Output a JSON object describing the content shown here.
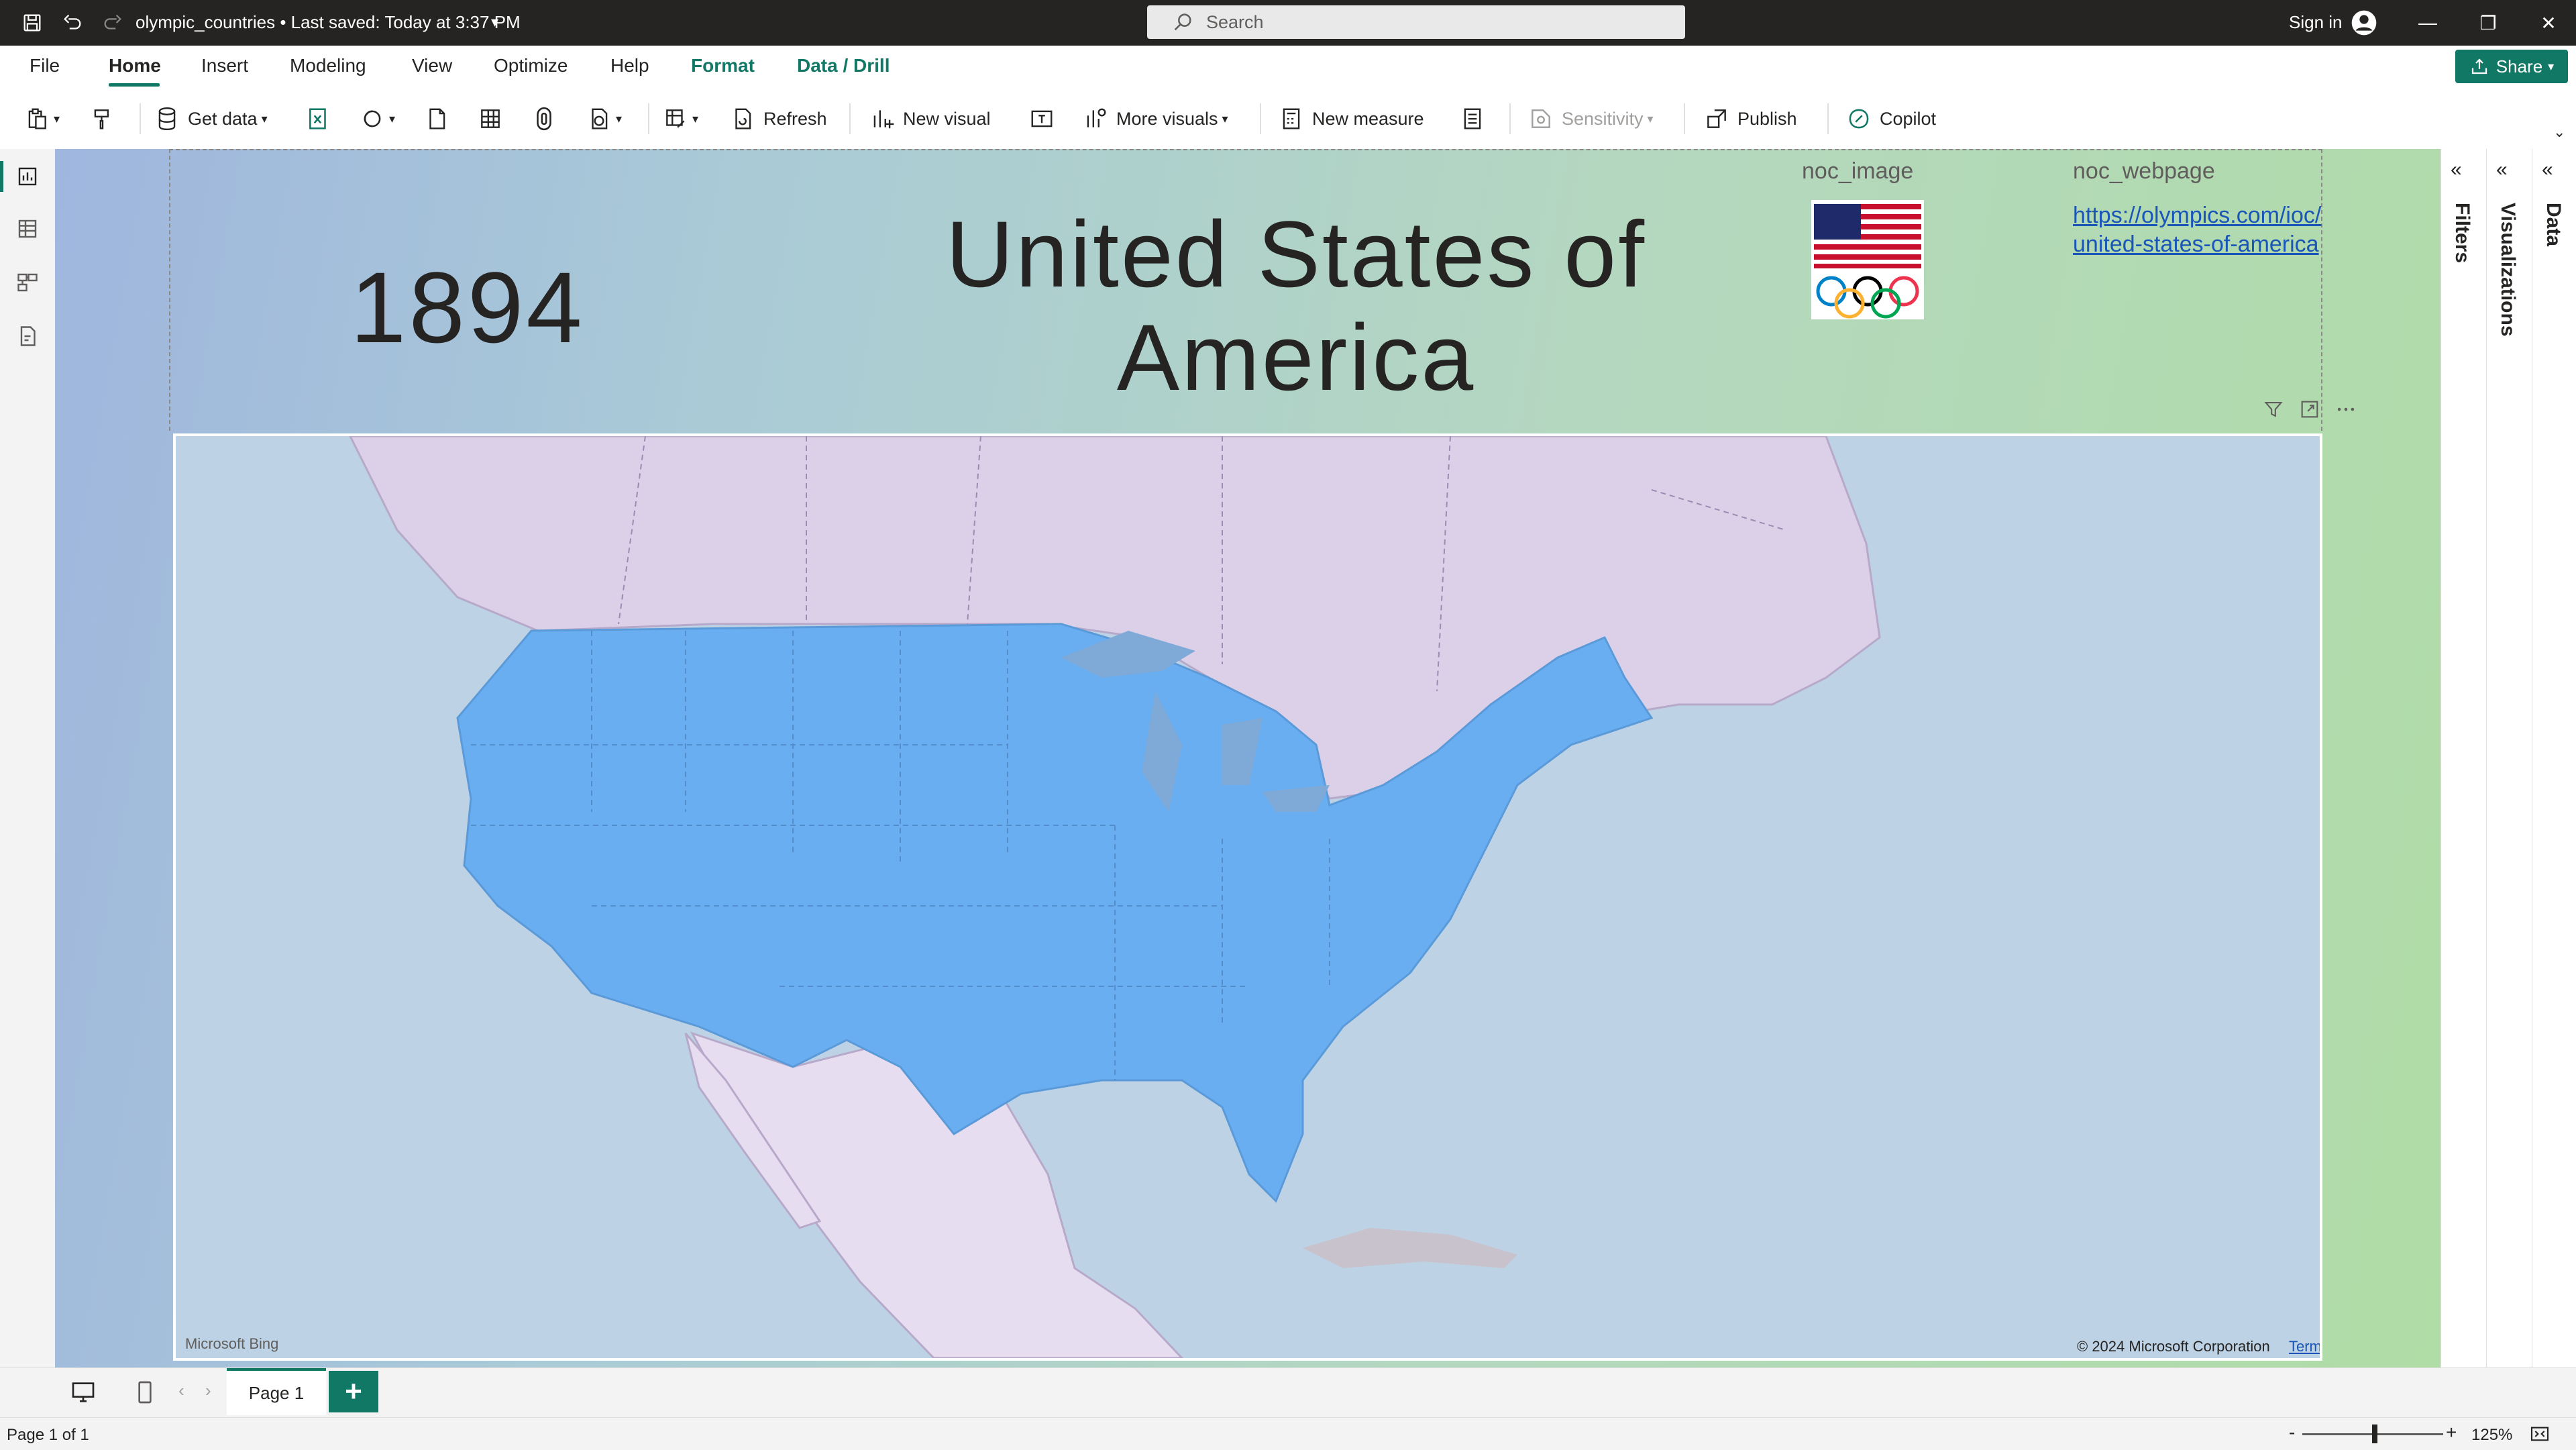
{
  "titlebar": {
    "doc_title": "olympic_countries • Last saved: Today at 3:37 PM",
    "search_placeholder": "Search",
    "sign_in": "Sign in"
  },
  "tabs": [
    "File",
    "Home",
    "Insert",
    "Modeling",
    "View",
    "Optimize",
    "Help",
    "Format",
    "Data / Drill"
  ],
  "active_tab": "Home",
  "share_label": "Share",
  "ribbon": {
    "get_data": "Get data",
    "refresh": "Refresh",
    "new_visual": "New visual",
    "more_visuals": "More visuals",
    "new_measure": "New measure",
    "sensitivity": "Sensitivity",
    "publish": "Publish",
    "copilot": "Copilot"
  },
  "report": {
    "year": "1894",
    "country_line1": "United States of",
    "country_line2": "America",
    "noc_image_label": "noc_image",
    "noc_webpage_label": "noc_webpage",
    "noc_webpage_url": "https://olympics.com/ioc/united-states-of-america"
  },
  "map": {
    "bing_logo": "Microsoft Bing",
    "copyright": "© 2024 Microsoft Corporation",
    "terms": "Terms",
    "highlight_color": "#6aaef2",
    "land_color": "#dcd0e8",
    "water_color": "#bdd2e4"
  },
  "panes": {
    "filters": "Filters",
    "visualizations": "Visualizations",
    "data": "Data"
  },
  "pages": {
    "tab": "Page 1",
    "add": "+",
    "status": "Page 1 of 1",
    "zoom": "125%"
  },
  "colors": {
    "accent": "#117865",
    "titlebar": "#252423",
    "link": "#1a56b8"
  }
}
